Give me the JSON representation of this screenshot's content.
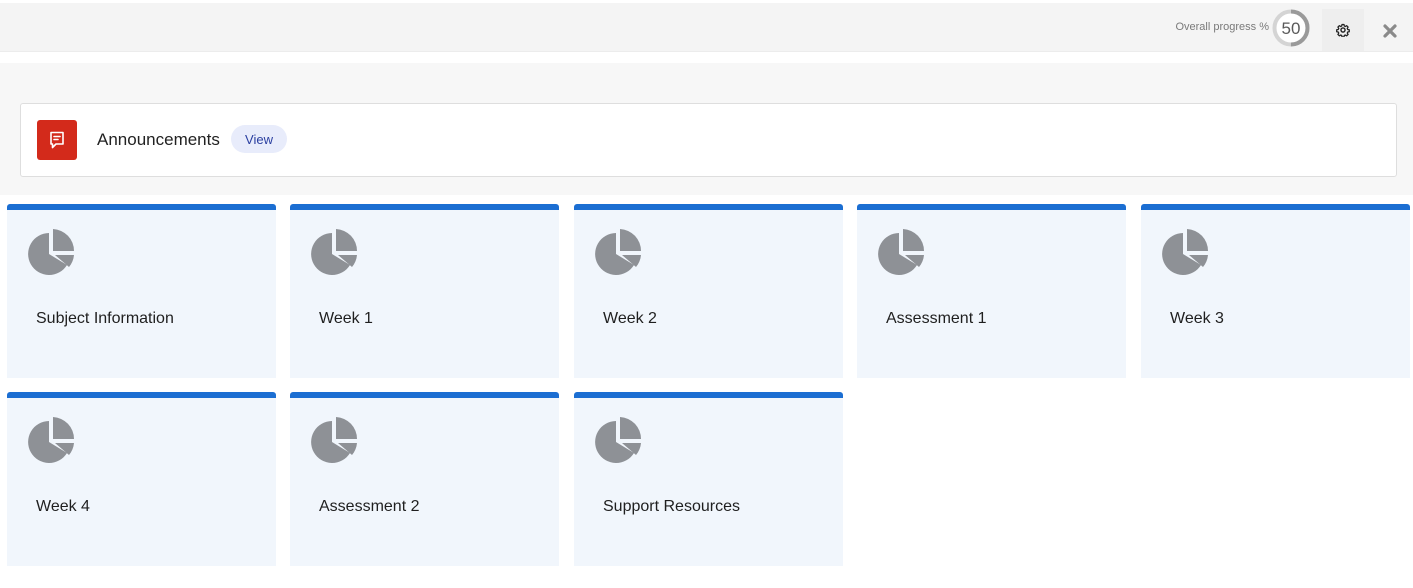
{
  "header": {
    "progress_label": "Overall progress %",
    "progress_value": "50",
    "progress_fraction": 0.5,
    "settings_icon": "gear-icon",
    "close_icon": "close-icon"
  },
  "announcements": {
    "title": "Announcements",
    "view_label": "View",
    "icon": "announcement-icon",
    "icon_color": "#d32a1b"
  },
  "tiles": [
    {
      "label": "Subject Information",
      "icon": "pie-chart-icon"
    },
    {
      "label": "Week 1",
      "icon": "pie-chart-icon"
    },
    {
      "label": "Week 2",
      "icon": "pie-chart-icon"
    },
    {
      "label": "Assessment 1",
      "icon": "pie-chart-icon"
    },
    {
      "label": "Week 3",
      "icon": "pie-chart-icon"
    },
    {
      "label": "Week 4",
      "icon": "pie-chart-icon"
    },
    {
      "label": "Assessment 2",
      "icon": "pie-chart-icon"
    },
    {
      "label": "Support Resources",
      "icon": "pie-chart-icon"
    }
  ],
  "colors": {
    "tile_accent": "#1b6ed2",
    "tile_background": "#f1f6fc",
    "icon_gray": "#8e9196"
  }
}
